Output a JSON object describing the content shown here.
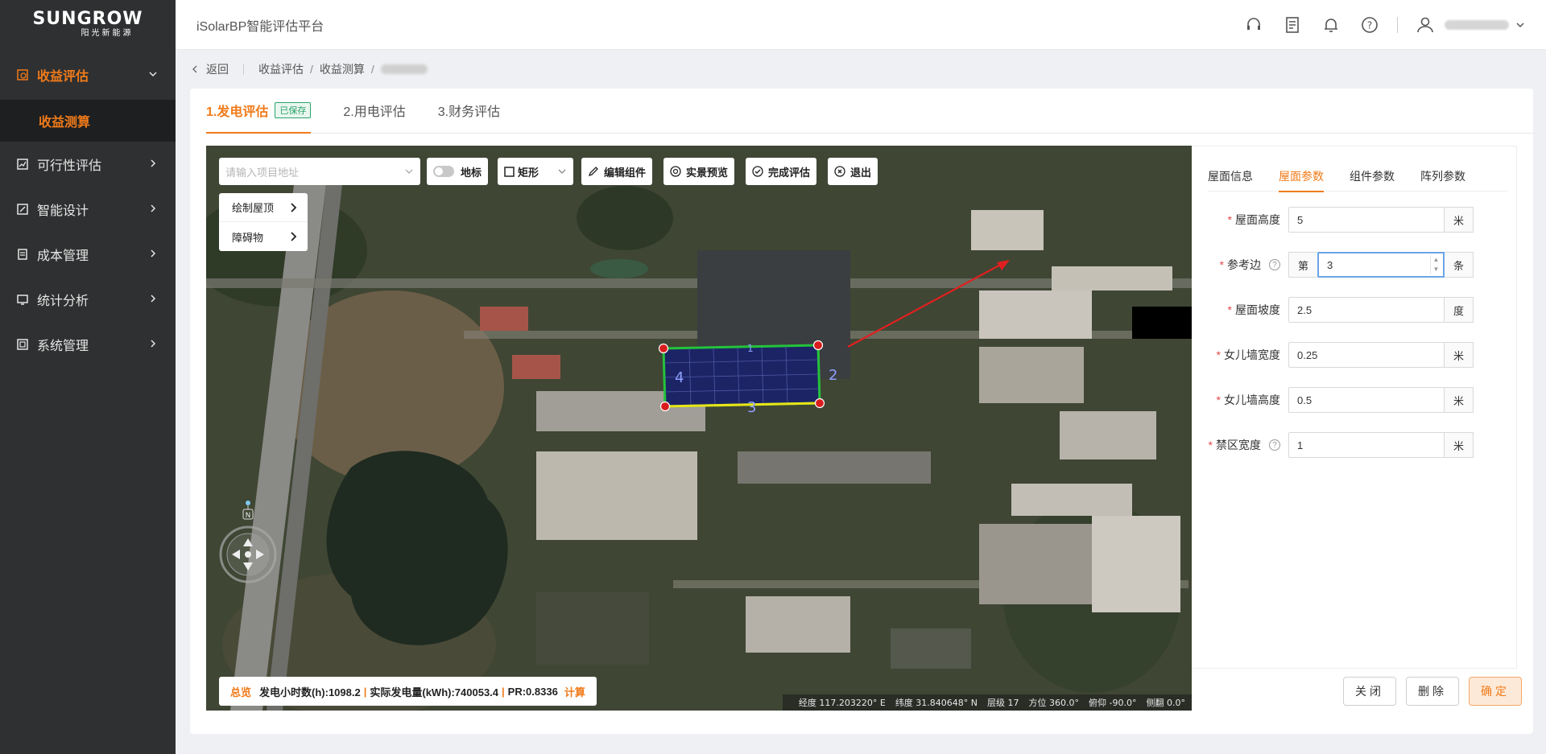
{
  "brand": {
    "name": "SUNGROW",
    "sub": "阳光新能源"
  },
  "app": {
    "title": "iSolarBP智能评估平台"
  },
  "sidebar": {
    "items": [
      {
        "label": "收益评估",
        "icon": "revenue-icon",
        "open": true
      },
      {
        "label": "可行性评估",
        "icon": "chart-icon"
      },
      {
        "label": "智能设计",
        "icon": "design-icon"
      },
      {
        "label": "成本管理",
        "icon": "cost-icon"
      },
      {
        "label": "统计分析",
        "icon": "stats-icon"
      },
      {
        "label": "系统管理",
        "icon": "system-icon"
      }
    ],
    "sub_active": "收益测算"
  },
  "breadcrumb": {
    "back": "返回",
    "items": [
      "收益评估",
      "收益测算"
    ],
    "separator": "/"
  },
  "tabs": [
    {
      "label": "1.发电评估",
      "badge": "已保存"
    },
    {
      "label": "2.用电评估"
    },
    {
      "label": "3.财务评估"
    }
  ],
  "map": {
    "address_placeholder": "请输入项目地址",
    "landmark_label": "地标",
    "shape_label": "矩形",
    "edit_label": "编辑组件",
    "preview_label": "实景预览",
    "finish_label": "完成评估",
    "exit_label": "退出",
    "draw_roof": "绘制屋顶",
    "obstacle": "障碍物",
    "edge_labels": [
      "4",
      "2",
      "3",
      "1"
    ],
    "compass_n": "N",
    "summary": {
      "prefix": "总览",
      "hours": "发电小时数(h):1098.2",
      "energy": "实际发电量(kWh):740053.4",
      "pr": "PR:0.8336",
      "calc": "计算"
    },
    "coords": {
      "lon": "经度  117.203220° E",
      "lat": "纬度  31.840648° N",
      "level": "层级  17",
      "heading": "方位  360.0°",
      "pitch": "俯仰  -90.0°",
      "roll": "侧翻  0.0°"
    }
  },
  "panel": {
    "tabs": [
      "屋面信息",
      "屋面参数",
      "组件参数",
      "阵列参数"
    ],
    "active_tab": 1,
    "fields": [
      {
        "label": "屋面高度",
        "value": "5",
        "unit": "米"
      },
      {
        "label": "参考边",
        "prefix": "第",
        "value": "3",
        "unit": "条",
        "help": true
      },
      {
        "label": "屋面坡度",
        "value": "2.5",
        "unit": "度"
      },
      {
        "label": "女儿墙宽度",
        "value": "0.25",
        "unit": "米"
      },
      {
        "label": "女儿墙高度",
        "value": "0.5",
        "unit": "米"
      },
      {
        "label": "禁区宽度",
        "value": "1",
        "unit": "米",
        "help": true
      }
    ],
    "buttons": {
      "close": "关闭",
      "delete": "删除",
      "confirm": "确定"
    }
  },
  "colors": {
    "accent": "#f07b1a",
    "sidebar": "#2f3031",
    "saved": "#2aa36b"
  }
}
